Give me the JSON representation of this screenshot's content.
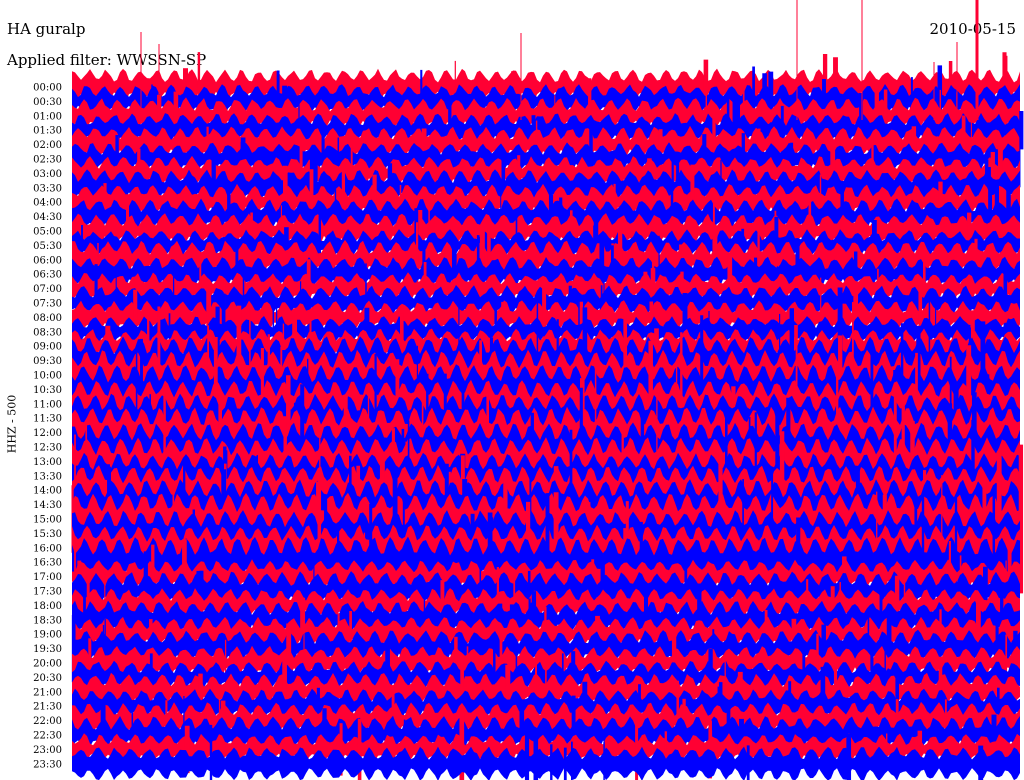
{
  "header": {
    "station": "HA guralp",
    "filter": "Applied filter: WWSSN-SP",
    "date": "2010-05-15"
  },
  "chart_data": {
    "type": "helicorder",
    "ylabel": "HHZ - 500",
    "row_labels": [
      "00:00",
      "00:30",
      "01:00",
      "01:30",
      "02:00",
      "02:30",
      "03:00",
      "03:30",
      "04:00",
      "04:30",
      "05:00",
      "05:30",
      "06:00",
      "06:30",
      "07:00",
      "07:30",
      "08:00",
      "08:30",
      "09:00",
      "09:30",
      "10:00",
      "10:30",
      "11:00",
      "11:30",
      "12:00",
      "12:30",
      "13:00",
      "13:30",
      "14:00",
      "14:30",
      "15:00",
      "15:30",
      "16:00",
      "16:30",
      "17:00",
      "17:30",
      "18:00",
      "18:30",
      "19:00",
      "19:30",
      "20:00",
      "20:30",
      "21:00",
      "21:30",
      "22:00",
      "22:30",
      "23:00",
      "23:30"
    ],
    "trace_colors": [
      "#ff0033",
      "#0000ff"
    ],
    "background": "#ffffff",
    "grid": false
  }
}
